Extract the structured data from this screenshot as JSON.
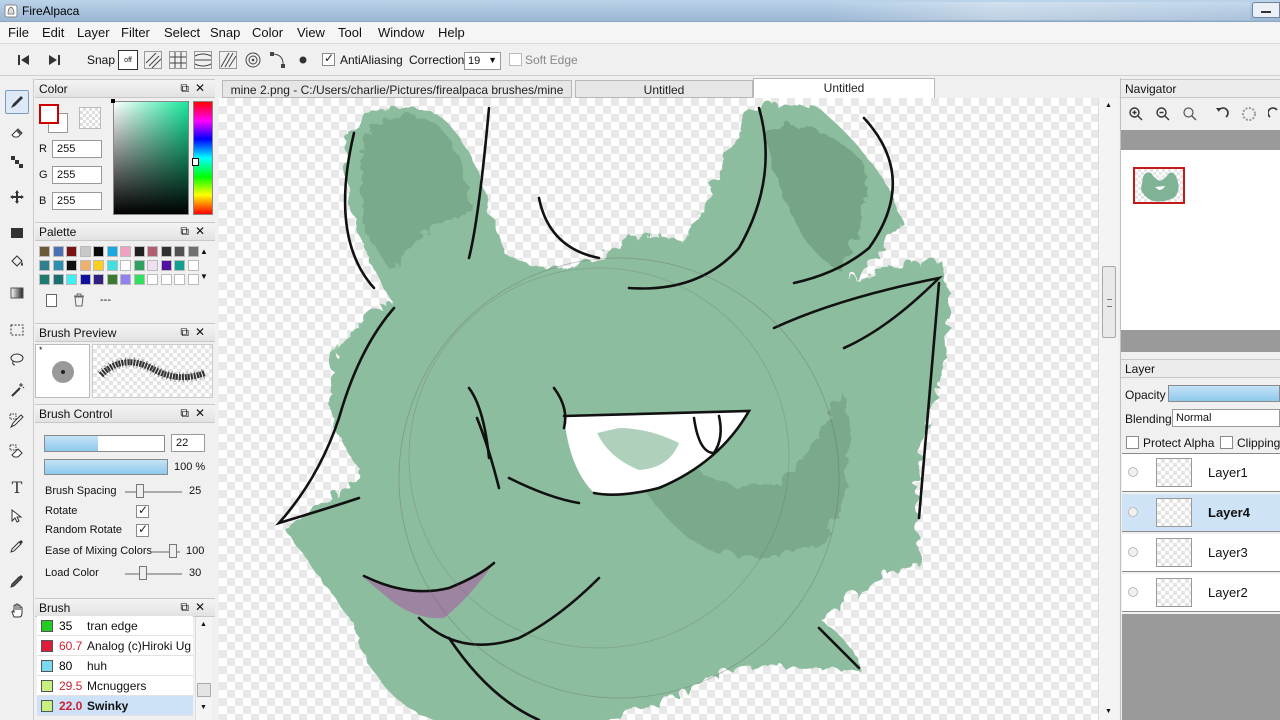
{
  "window": {
    "title": "FireAlpaca"
  },
  "menu": [
    "File",
    "Edit",
    "Layer",
    "Filter",
    "Select",
    "Snap",
    "Color",
    "View",
    "Tool",
    "Window",
    "Help"
  ],
  "toolbar": {
    "snap_label": "Snap",
    "snap_off_label": "off",
    "antialiasing_label": "AntiAliasing",
    "antialiasing_checked": true,
    "correction_label": "Correction",
    "correction_value": "19",
    "soft_edge_label": "Soft Edge",
    "soft_edge_checked": false
  },
  "tabs": [
    {
      "label": "mine 2.png - C:/Users/charlie/Pictures/firealpaca brushes/mine 2.png",
      "active": false
    },
    {
      "label": "Untitled",
      "active": false
    },
    {
      "label": "Untitled",
      "active": true
    }
  ],
  "color_panel": {
    "title": "Color",
    "r_label": "R",
    "r_value": "255",
    "g_label": "G",
    "g_value": "255",
    "b_label": "B",
    "b_value": "255",
    "primary": "#ffffff",
    "primary_border": "#cc0000"
  },
  "palette_panel": {
    "title": "Palette",
    "more_label": "---",
    "colors": [
      "#6b5a3a",
      "#4a6fb3",
      "#7a1414",
      "#c8c8c8",
      "#0a0a0a",
      "#18a8e0",
      "#f0a0c0",
      "#202020",
      "#b06070",
      "#303030",
      "#505050",
      "#707070",
      "#2f7f8f",
      "#2c8fb0",
      "#101010",
      "#f0b070",
      "#ffd020",
      "#40e0e0",
      "#ffffff",
      "#30a060",
      "#f0e0f0",
      "#5010a0",
      "#10a090",
      "#ffffff",
      "#1f7a70",
      "#1c6f6f",
      "#40f0f0",
      "#1010a0",
      "#302080",
      "#3a7a30",
      "#9080f0",
      "#30e060",
      "#ffffff",
      "#ffffff",
      "#ffffff",
      "#ffffff"
    ]
  },
  "brush_preview_panel": {
    "title": "Brush Preview"
  },
  "brush_control_panel": {
    "title": "Brush Control",
    "size_value": "22",
    "opacity_value": "100 %",
    "spacing_label": "Brush Spacing",
    "spacing_value": "25",
    "rotate_label": "Rotate",
    "rotate_checked": true,
    "random_rotate_label": "Random Rotate",
    "random_rotate_checked": true,
    "mixing_label": "Ease of Mixing Colors",
    "mixing_value": "100",
    "load_label": "Load Color",
    "load_value": "30"
  },
  "brush_panel": {
    "title": "Brush",
    "items": [
      {
        "color": "#22cc22",
        "size": "35",
        "name": "tran edge",
        "size_color": "#000000",
        "selected": false
      },
      {
        "color": "#e01c3c",
        "size": "60.7",
        "name": "Analog (c)Hiroki Ug",
        "size_color": "#cc2233",
        "selected": false
      },
      {
        "color": "#7ad8f0",
        "size": "80",
        "name": "huh",
        "size_color": "#000000",
        "selected": false
      },
      {
        "color": "#c8f080",
        "size": "29.5",
        "name": "Mcnuggers",
        "size_color": "#cc2233",
        "selected": false
      },
      {
        "color": "#c8f080",
        "size": "22.0",
        "name": "Swinky",
        "size_color": "#cc2233",
        "selected": true
      }
    ]
  },
  "navigator_panel": {
    "title": "Navigator"
  },
  "layer_panel": {
    "title": "Layer",
    "opacity_label": "Opacity",
    "opacity_value": 1.0,
    "blending_label": "Blending",
    "blending_value": "Normal",
    "protect_alpha_label": "Protect Alpha",
    "clipping_label": "Clipping",
    "layers": [
      {
        "name": "Layer1",
        "selected": false
      },
      {
        "name": "Layer4",
        "selected": true
      },
      {
        "name": "Layer3",
        "selected": false
      },
      {
        "name": "Layer2",
        "selected": false
      }
    ]
  },
  "colors": {
    "accent": "#7ec3ec",
    "selection": "#cfe3f7",
    "artwork_green": "#88b89a"
  }
}
